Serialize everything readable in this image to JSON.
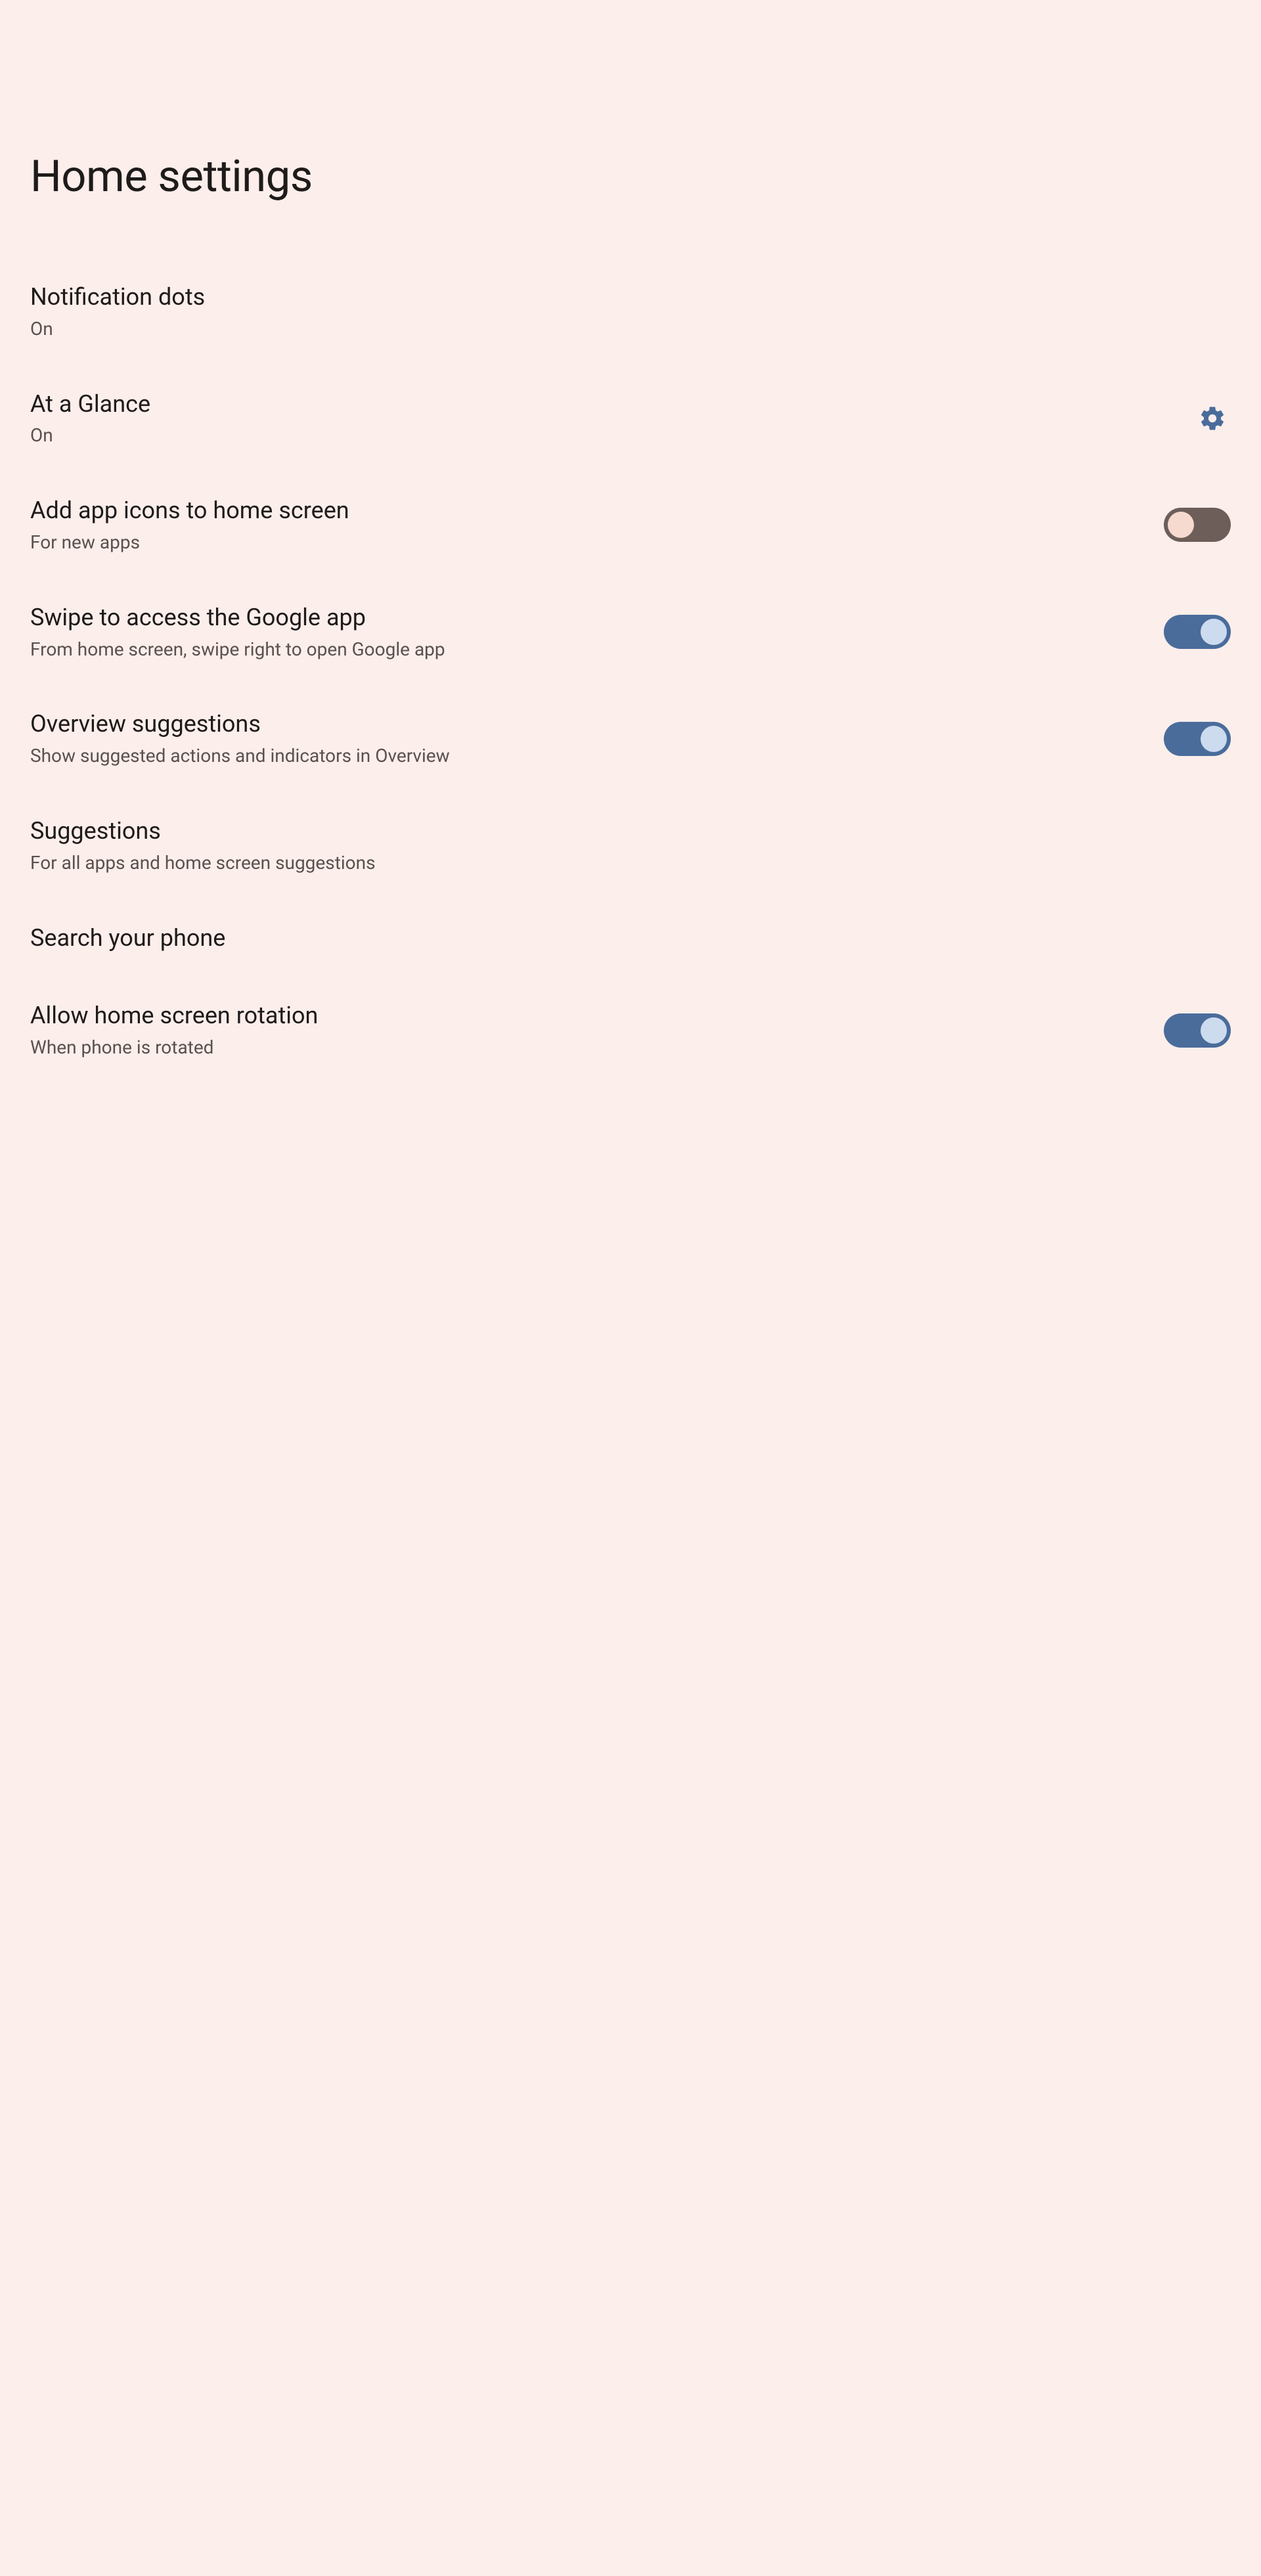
{
  "title": "Home settings",
  "items": [
    {
      "title": "Notification dots",
      "sub": "On",
      "control": "none"
    },
    {
      "title": "At a Glance",
      "sub": "On",
      "control": "gear"
    },
    {
      "title": "Add app icons to home screen",
      "sub": "For new apps",
      "control": "switch",
      "on": false
    },
    {
      "title": "Swipe to access the Google app",
      "sub": "From home screen, swipe right to open Google app",
      "control": "switch",
      "on": true
    },
    {
      "title": "Overview suggestions",
      "sub": "Show suggested actions and indicators in Overview",
      "control": "switch",
      "on": true
    },
    {
      "title": "Suggestions",
      "sub": "For all apps and home screen suggestions",
      "control": "none"
    },
    {
      "title": "Search your phone",
      "sub": "",
      "control": "none"
    },
    {
      "title": "Allow home screen rotation",
      "sub": "When phone is rotated",
      "control": "switch",
      "on": true
    }
  ]
}
